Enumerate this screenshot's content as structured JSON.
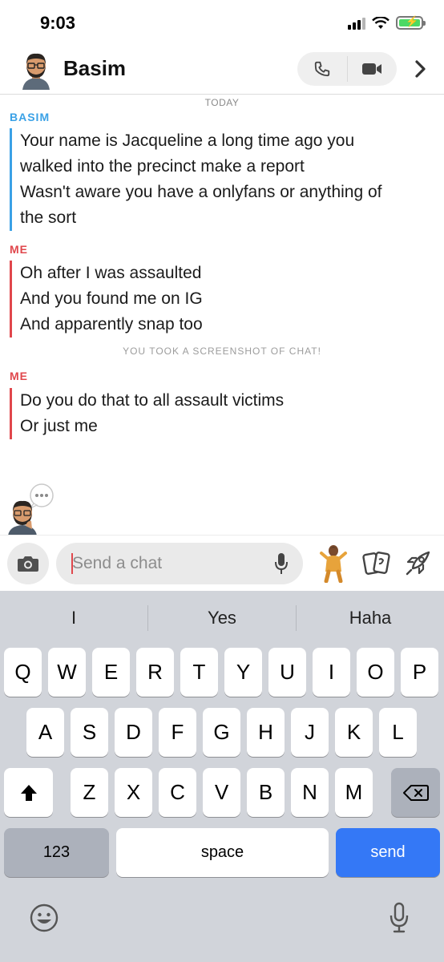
{
  "status_bar": {
    "time": "9:03"
  },
  "header": {
    "contact_name": "Basim"
  },
  "chat": {
    "day_label": "TODAY",
    "notice": "YOU TOOK A SCREENSHOT OF CHAT!",
    "messages": [
      {
        "sender": "BASIM",
        "lines": [
          "Your name is Jacqueline a long time ago you",
          "walked into the precinct make a report",
          "Wasn't aware you have a onlyfans or anything of",
          "the sort"
        ]
      },
      {
        "sender": "ME",
        "lines": [
          "Oh after I was assaulted",
          "And you found me on IG",
          "And apparently snap too"
        ]
      },
      {
        "sender": "ME",
        "lines": [
          "Do you do that to all assault victims",
          "Or just me"
        ]
      }
    ]
  },
  "compose": {
    "placeholder": "Send a chat"
  },
  "keyboard": {
    "suggestions": [
      "I",
      "Yes",
      "Haha"
    ],
    "row1": [
      "Q",
      "W",
      "E",
      "R",
      "T",
      "Y",
      "U",
      "I",
      "O",
      "P"
    ],
    "row2": [
      "A",
      "S",
      "D",
      "F",
      "G",
      "H",
      "J",
      "K",
      "L"
    ],
    "row3": [
      "Z",
      "X",
      "C",
      "V",
      "B",
      "N",
      "M"
    ],
    "numbers_label": "123",
    "space_label": "space",
    "send_label": "send"
  },
  "colors": {
    "them": "#3aa1e6",
    "me": "#e0474c",
    "send_key": "#3478f6"
  }
}
